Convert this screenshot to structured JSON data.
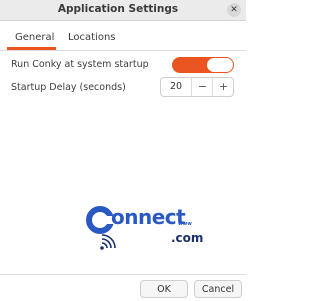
{
  "window": {
    "title": "Application Settings",
    "close_icon": "close-icon",
    "close_glyph": "✕"
  },
  "tabs": [
    {
      "label": "General",
      "selected": true
    },
    {
      "label": "Locations",
      "selected": false
    }
  ],
  "settings": {
    "run_at_startup": {
      "label": "Run Conky at system startup",
      "enabled": true
    },
    "startup_delay": {
      "label": "Startup Delay (seconds)",
      "value": "20",
      "decrement_glyph": "−",
      "increment_glyph": "+"
    }
  },
  "watermark": {
    "word": "onnect",
    "www": "www",
    "domain_suffix": ".com"
  },
  "buttons": {
    "ok": "OK",
    "cancel": "Cancel"
  },
  "colors": {
    "accent": "#e95420",
    "logo_blue": "#2b59c3",
    "logo_navy": "#1a2f70"
  }
}
